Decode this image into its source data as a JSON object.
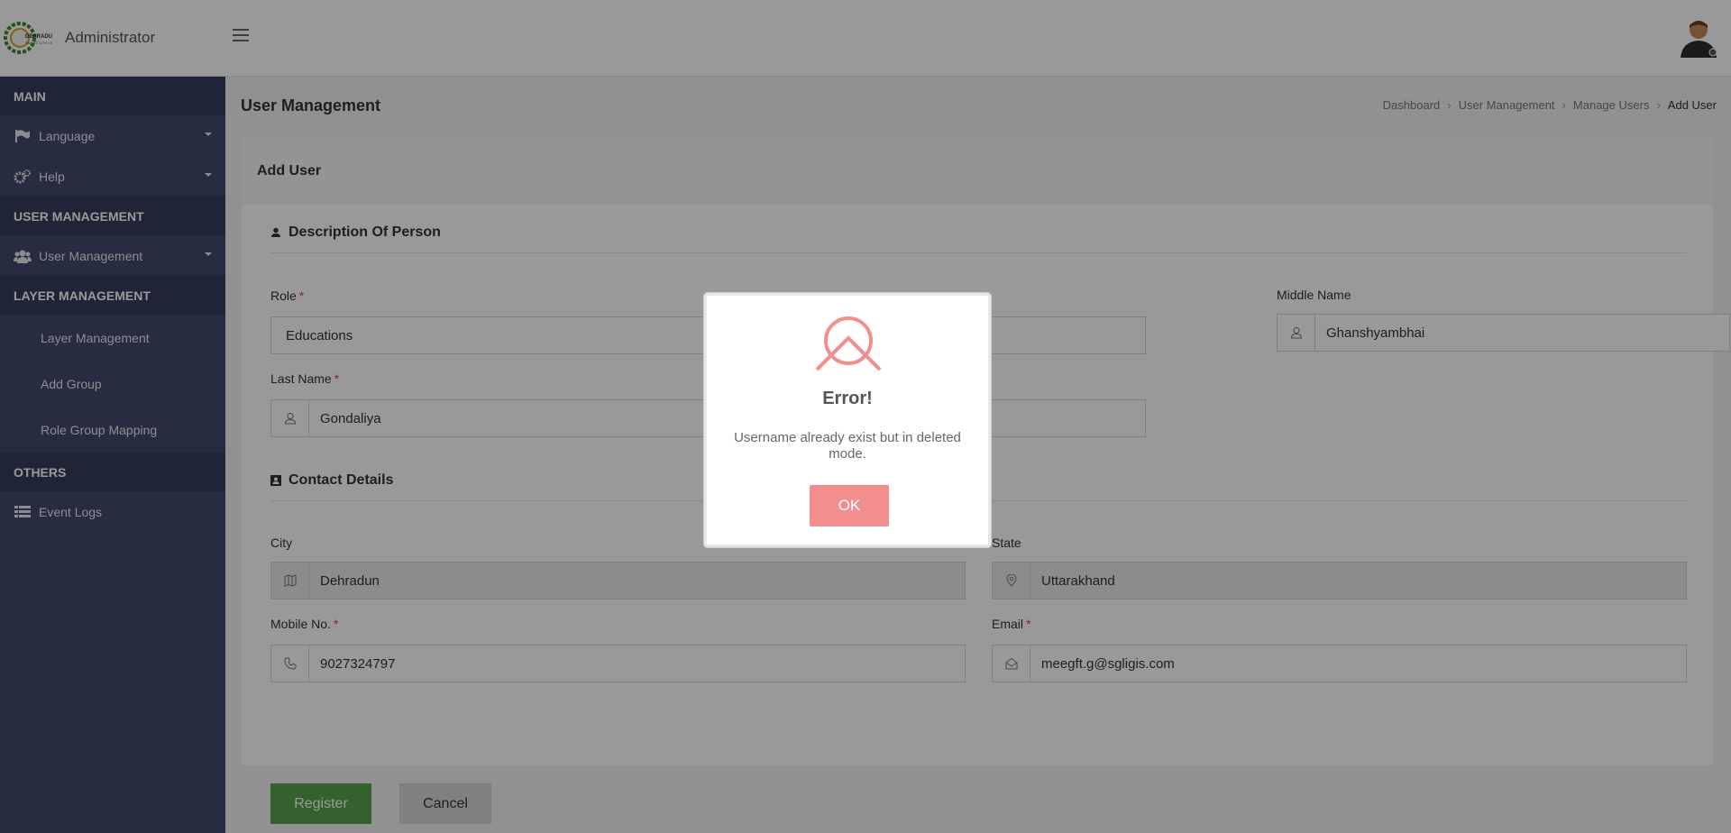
{
  "header": {
    "title": "Administrator",
    "logo_text": "DEHRADUN SMART CITY LTD"
  },
  "sidebar": {
    "sections": [
      {
        "label": "MAIN"
      },
      {
        "label": "USER MANAGEMENT"
      },
      {
        "label": "LAYER MANAGEMENT"
      },
      {
        "label": "OTHERS"
      }
    ],
    "items": {
      "language": "Language",
      "help": "Help",
      "user_management": "User Management",
      "layer_management": "Layer Management",
      "add_group": "Add Group",
      "role_group_mapping": "Role Group Mapping",
      "event_logs": "Event Logs"
    }
  },
  "main": {
    "page_title": "User Management",
    "breadcrumb": [
      "Dashboard",
      "User Management",
      "Manage Users",
      "Add User"
    ],
    "card_title": "Add User",
    "section_person": "Description Of Person",
    "section_contact": "Contact Details",
    "fields": {
      "role": {
        "label": "Role",
        "value": "Educations"
      },
      "middle_name": {
        "label": "Middle Name",
        "value": "Ghanshyambhai"
      },
      "last_name": {
        "label": "Last Name",
        "value": "Gondaliya"
      },
      "city": {
        "label": "City",
        "value": "Dehradun"
      },
      "state": {
        "label": "State",
        "value": "Uttarakhand"
      },
      "mobile": {
        "label": "Mobile No.",
        "value": "9027324797"
      },
      "email": {
        "label": "Email",
        "value": "meegft.g@sgligis.com"
      }
    },
    "buttons": {
      "register": "Register",
      "cancel": "Cancel"
    }
  },
  "modal": {
    "title": "Error!",
    "message": "Username already exist but in deleted mode.",
    "ok_label": "OK"
  },
  "colors": {
    "sidebar_bg": "#414a6d",
    "register_green": "#57a24b",
    "error_red": "#f28e8e"
  }
}
